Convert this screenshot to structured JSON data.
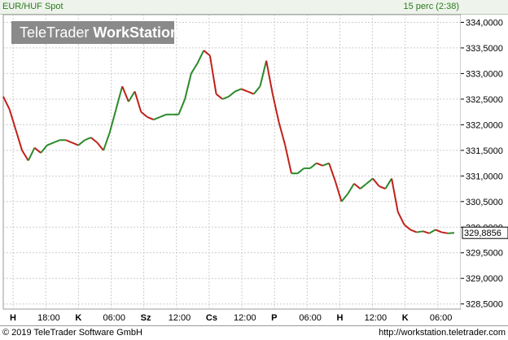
{
  "header": {
    "symbol": "EUR/HUF Spot",
    "delay": "15 perc (2:38)"
  },
  "logo": {
    "part1": "TeleTrader ",
    "part2": "WorkStation"
  },
  "footer": {
    "copyright": "© 2019 TeleTrader Software GmbH",
    "url": "http://workstation.teletrader.com"
  },
  "chart_data": {
    "type": "line",
    "title": "EUR/HUF Spot",
    "ylim": [
      328.4,
      334.15
    ],
    "y_ticks": [
      "334,0000",
      "333,5000",
      "333,0000",
      "332,5000",
      "332,0000",
      "331,5000",
      "331,0000",
      "330,5000",
      "330,0000",
      "329,5000",
      "329,0000",
      "328,5000"
    ],
    "y_tick_values": [
      334.0,
      333.5,
      333.0,
      332.5,
      332.0,
      331.5,
      331.0,
      330.5,
      330.0,
      329.5,
      329.0,
      328.5
    ],
    "x_ticks": [
      "H",
      "18:00",
      "K",
      "06:00",
      "Sz",
      "12:00",
      "Cs",
      "12:00",
      "P",
      "06:00",
      "H",
      "12:00",
      "K",
      "06:00"
    ],
    "last_value": "329,8856",
    "grid": true,
    "series": [
      {
        "values": [
          332.55,
          332.3,
          331.9,
          331.5,
          331.3,
          331.55,
          331.45,
          331.6,
          331.65,
          331.7,
          331.7,
          331.65,
          331.6,
          331.7,
          331.75,
          331.65,
          331.5,
          331.85,
          332.3,
          332.75,
          332.45,
          332.65,
          332.25,
          332.15,
          332.1,
          332.15,
          332.2,
          332.2,
          332.2,
          332.5,
          333.0,
          333.2,
          333.45,
          333.35,
          332.6,
          332.5,
          332.55,
          332.65,
          332.7,
          332.65,
          332.6,
          332.75,
          333.25,
          332.6,
          332.05,
          331.6,
          331.05,
          331.05,
          331.15,
          331.15,
          331.25,
          331.2,
          331.25,
          330.9,
          330.5,
          330.65,
          330.85,
          330.75,
          330.85,
          330.95,
          330.8,
          330.75,
          330.95,
          330.3,
          330.05,
          329.95,
          329.9,
          329.92,
          329.88,
          329.95,
          329.9,
          329.88,
          329.89
        ]
      }
    ]
  }
}
